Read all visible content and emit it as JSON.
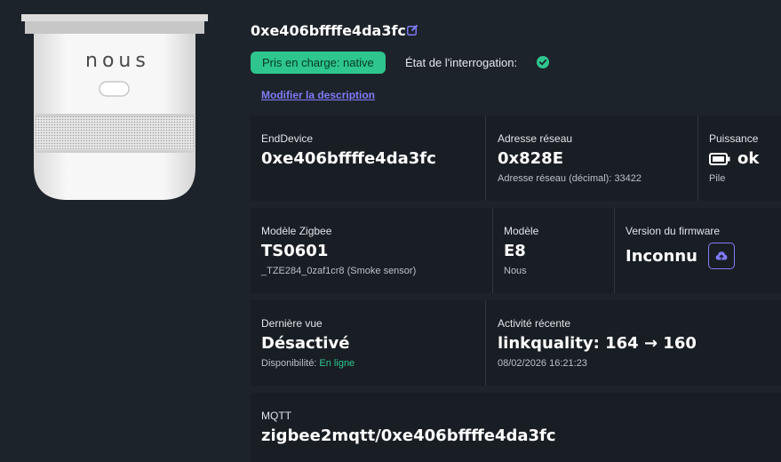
{
  "device": {
    "title": "0xe406bffffe4da3fc",
    "support_badge": "Pris en charge: native",
    "interrogation_label": "État de l'interrogation:",
    "modify_description": "Modifier la description",
    "brand_logo": "nous",
    "icons": {
      "edit": "edit-icon",
      "interrogation_status": "check-circle-icon",
      "power": "battery-icon",
      "firmware": "cloud-upload-icon"
    },
    "colors": {
      "background": "#1d232a",
      "panel": "#191e24",
      "accent": "#7f7cf7",
      "success": "#2ec58f"
    }
  },
  "info": {
    "end_device": {
      "label": "EndDevice",
      "value": "0xe406bffffe4da3fc"
    },
    "network_address": {
      "label": "Adresse réseau",
      "value": "0x828E",
      "sub": "Adresse réseau (décimal): 33422"
    },
    "power": {
      "label": "Puissance",
      "value": "ok",
      "sub": "Pile"
    },
    "zigbee_model": {
      "label": "Modèle Zigbee",
      "value": "TS0601",
      "sub": "_TZE284_0zaf1cr8 (Smoke sensor)"
    },
    "model": {
      "label": "Modèle",
      "value": "E8",
      "sub": "Nous"
    },
    "firmware": {
      "label": "Version du firmware",
      "value": "Inconnu"
    },
    "last_seen": {
      "label": "Dernière vue",
      "value": "Désactivé",
      "sub_prefix": "Disponibilité: ",
      "sub_status": "En ligne"
    },
    "recent_activity": {
      "label": "Activité récente",
      "value": "linkquality: 164 → 160",
      "sub": "08/02/2026 16:21:23"
    },
    "mqtt": {
      "label": "MQTT",
      "value": "zigbee2mqtt/0xe406bffffe4da3fc"
    }
  }
}
